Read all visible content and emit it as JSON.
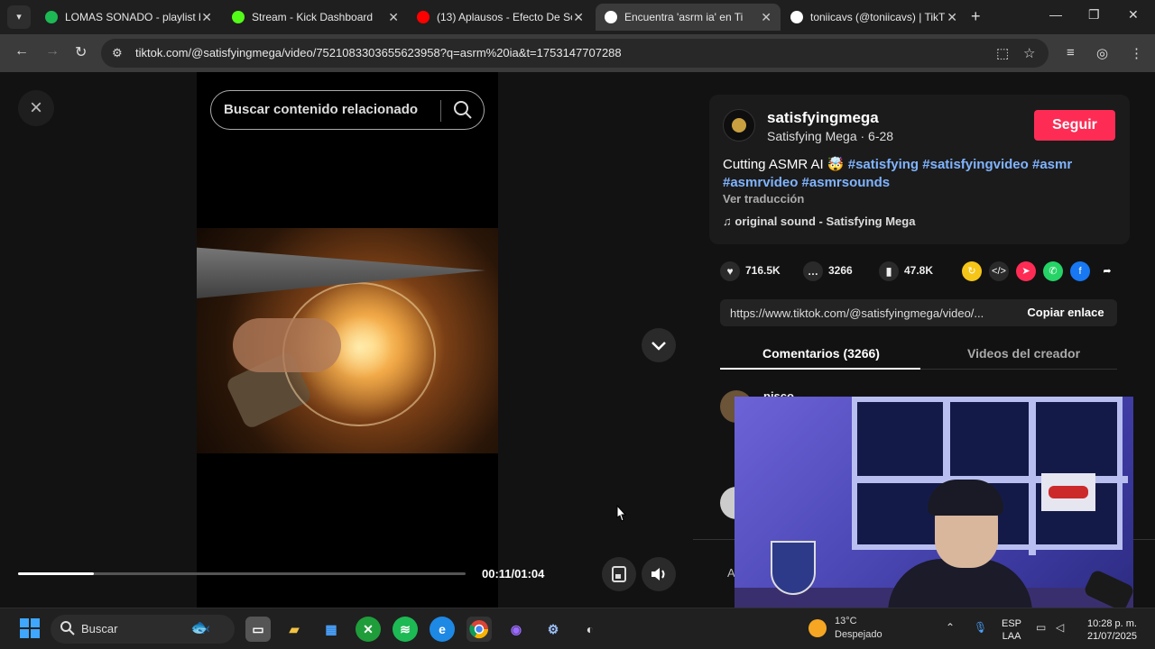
{
  "browser": {
    "tabs": [
      {
        "title": "LOMAS SONADO - playlist b",
        "color": "#1db954",
        "active": false
      },
      {
        "title": "Stream - Kick Dashboard",
        "color": "#53fc18",
        "active": false
      },
      {
        "title": "(13) Aplausos - Efecto De So",
        "color": "#ff0000",
        "active": false
      },
      {
        "title": "Encuentra 'asrm ia' en Ti",
        "color": "#ffffff",
        "active": true
      },
      {
        "title": "toniicavs (@toniicavs) | TikT",
        "color": "#ffffff",
        "active": false
      }
    ],
    "url": "tiktok.com/@satisfyingmega/video/7521083303655623958?q=asrm%20ia&t=1753147707288"
  },
  "video": {
    "search_placeholder": "Buscar contenido relacionado",
    "time": "00:11/01:04",
    "progress": 0.17
  },
  "post": {
    "username": "satisfyingmega",
    "nick_line": "Satisfying Mega · 6-28",
    "follow_label": "Seguir",
    "caption_text": "Cutting ASMR AI 🤯",
    "hashtags_line1": "#satisfying #satisfyingvideo #asmr",
    "hashtags_line2": "#asmrvideo #asmrsounds",
    "translate_label": "Ver traducción",
    "sound_label": "original sound - Satisfying Mega",
    "likes": "716.5K",
    "comments": "3266",
    "saves": "47.8K",
    "link": "https://www.tiktok.com/@satisfyingmega/video/...",
    "copy_label": "Copiar enlace",
    "tab_comments": "Comentarios (3266)",
    "tab_creator": "Videos del creador",
    "comment_author": "pisco",
    "comment_input_hint": "A"
  },
  "taskbar": {
    "search_label": "Buscar",
    "weather_temp": "13°C",
    "weather_cond": "Despejado",
    "lang_line1": "ESP",
    "lang_line2": "LAA",
    "time": "10:28 p. m.",
    "date": "21/07/2025"
  },
  "colors": {
    "accent": "#fe2c55",
    "hashtag": "#80b4ff"
  }
}
